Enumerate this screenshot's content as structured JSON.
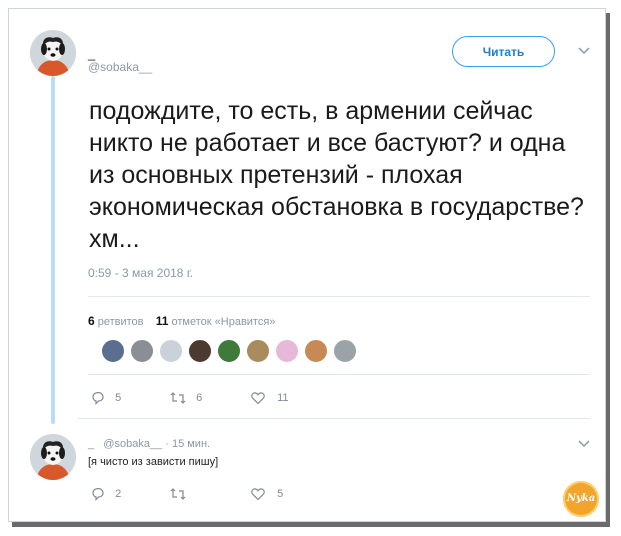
{
  "tweet": {
    "display_name": "_",
    "handle": "@sobaka__",
    "follow_label": "Читать",
    "text": "подождите, то есть, в армении сейчас никто не работает и все бастуют? и одна из основных претензий - плохая экономическая обстановка в государстве? хм...",
    "timestamp": "0:59 - 3 мая 2018 г.",
    "stats": {
      "retweets_count": "6",
      "retweets_label": "ретвитов",
      "likes_count": "11",
      "likes_label": "отметок «Нравится»"
    },
    "actions": {
      "replies": "5",
      "retweets": "6",
      "likes": "11"
    }
  },
  "reply": {
    "display_name": "_",
    "handle_time": "@sobaka__ · 15 мин.",
    "text": "[я чисто из зависти пишу]",
    "actions": {
      "replies": "2",
      "retweets": "",
      "likes": "5"
    }
  },
  "watermark": {
    "text": "Nyka"
  },
  "colors": {
    "accent": "#1d7fc8",
    "thread_line": "#b7dcf5",
    "muted": "#8b98a5"
  }
}
